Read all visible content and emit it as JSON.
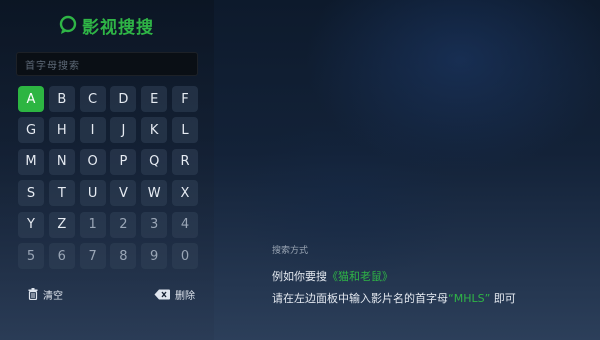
{
  "app": {
    "title": "影视搜搜",
    "accent_color": "#2fb546"
  },
  "search": {
    "placeholder": "首字母搜索"
  },
  "keyboard": {
    "selected": "A",
    "rows": [
      [
        "A",
        "B",
        "C",
        "D",
        "E",
        "F"
      ],
      [
        "G",
        "H",
        "I",
        "J",
        "K",
        "L"
      ],
      [
        "M",
        "N",
        "O",
        "P",
        "Q",
        "R"
      ],
      [
        "S",
        "T",
        "U",
        "V",
        "W",
        "X"
      ],
      [
        "Y",
        "Z",
        "1",
        "2",
        "3",
        "4"
      ],
      [
        "5",
        "6",
        "7",
        "8",
        "9",
        "0"
      ]
    ]
  },
  "actions": {
    "clear_label": "清空",
    "clear_icon": "trash-icon",
    "delete_label": "删除",
    "delete_icon": "backspace-icon"
  },
  "hint": {
    "title": "搜索方式",
    "line1_prefix": "例如你要搜",
    "line1_example": "《猫和老鼠》",
    "line2_prefix": "请在左边面板中输入影片名的首字母",
    "line2_example": "“MHLS”",
    "line2_suffix": " 即可"
  }
}
